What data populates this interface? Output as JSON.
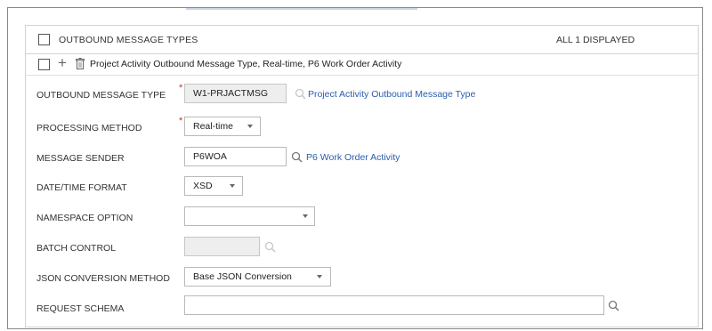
{
  "section": {
    "title": "OUTBOUND MESSAGE TYPES",
    "count_label": "ALL 1 DISPLAYED"
  },
  "record": {
    "title": "Project Activity Outbound Message Type, Real-time, P6 Work Order Activity"
  },
  "fields": {
    "outbound_message_type": {
      "label": "OUTBOUND MESSAGE TYPE",
      "value": "W1-PRJACTMSG",
      "description": "Project Activity Outbound Message Type"
    },
    "processing_method": {
      "label": "PROCESSING METHOD",
      "value": "Real-time"
    },
    "message_sender": {
      "label": "MESSAGE SENDER",
      "value": "P6WOA",
      "description": "P6 Work Order Activity"
    },
    "datetime_format": {
      "label": "DATE/TIME FORMAT",
      "value": "XSD"
    },
    "namespace_option": {
      "label": "NAMESPACE OPTION",
      "value": ""
    },
    "batch_control": {
      "label": "BATCH CONTROL",
      "value": ""
    },
    "json_conversion_method": {
      "label": "JSON CONVERSION METHOD",
      "value": "Base JSON Conversion"
    },
    "request_schema": {
      "label": "REQUEST SCHEMA",
      "value": ""
    }
  },
  "colors": {
    "link": "#2a5db0",
    "required": "#c0392b",
    "readonly_bg": "#eeeeee"
  },
  "icons": [
    "checkbox-icon",
    "add-icon",
    "trash-icon",
    "search-icon",
    "chevron-down-icon"
  ]
}
